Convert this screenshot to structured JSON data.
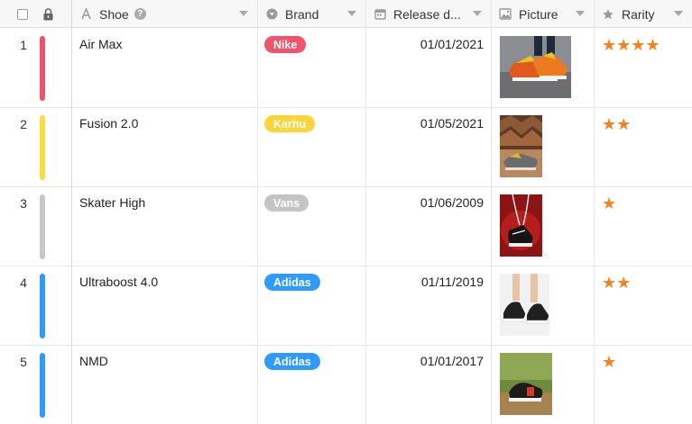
{
  "columns": {
    "shoe": "Shoe",
    "brand": "Brand",
    "release": "Release d...",
    "picture": "Picture",
    "rarity": "Rarity"
  },
  "rows": [
    {
      "num": "1",
      "bar_color": "#f0546b",
      "shoe": "Air Max",
      "brand": "Nike",
      "brand_color": "#f0546b",
      "date": "01/01/2021",
      "rarity": "★★★★",
      "rarity_value": 4
    },
    {
      "num": "2",
      "bar_color": "#fddc3f",
      "shoe": "Fusion 2.0",
      "brand": "Karhu",
      "brand_color": "#fdd53a",
      "date": "01/05/2021",
      "rarity": "★★",
      "rarity_value": 2
    },
    {
      "num": "3",
      "bar_color": "#c8c8c8",
      "shoe": "Skater High",
      "brand": "Vans",
      "brand_color": "#c4c4c4",
      "date": "01/06/2009",
      "rarity": "★",
      "rarity_value": 1
    },
    {
      "num": "4",
      "bar_color": "#2f9bff",
      "shoe": "Ultraboost 4.0",
      "brand": "Adidas",
      "brand_color": "#2f9bff",
      "date": "01/11/2019",
      "rarity": "★★",
      "rarity_value": 2
    },
    {
      "num": "5",
      "bar_color": "#2f9bff",
      "shoe": "NMD",
      "brand": "Adidas",
      "brand_color": "#2f9bff",
      "date": "01/01/2017",
      "rarity": "★",
      "rarity_value": 1
    }
  ],
  "colors": {
    "star": "#f5821f",
    "header_bg": "#f7f7f7",
    "grid_line": "#e6e6e6"
  },
  "icons": {
    "select_all": "checkbox-icon",
    "lock": "lock-icon",
    "shoe": "text-type-icon",
    "brand": "single-select-icon",
    "release": "calendar-icon",
    "picture": "image-icon",
    "rarity": "star-icon"
  }
}
